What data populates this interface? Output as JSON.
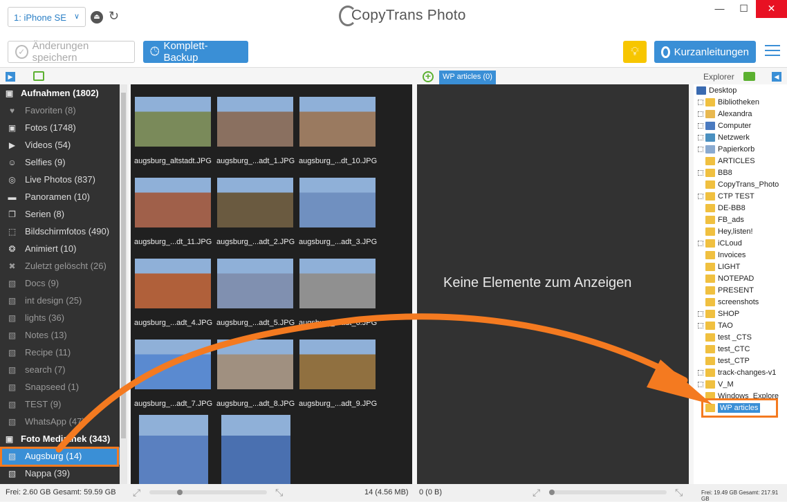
{
  "app": {
    "title": "CopyTrans Photo",
    "colors": {
      "accent": "#3a8fd6",
      "highlight": "#f47a20",
      "tip": "#f7c600"
    }
  },
  "device": {
    "selected": "1: iPhone SE"
  },
  "toolbar": {
    "save_label": "Änderungen speichern",
    "backup_label": "Komplett-Backup",
    "guide_label": "Kurzanleitungen"
  },
  "left_header": {},
  "sidebar": {
    "items": [
      {
        "label": "Aufnahmen (1802)",
        "icon": "camera-icon",
        "type": "header"
      },
      {
        "label": "Favoriten (8)",
        "icon": "heart-icon",
        "type": "dim"
      },
      {
        "label": "Fotos (1748)",
        "icon": "camera-icon",
        "type": "normal"
      },
      {
        "label": "Videos (54)",
        "icon": "video-icon",
        "type": "normal"
      },
      {
        "label": "Selfies (9)",
        "icon": "selfie-icon",
        "type": "normal"
      },
      {
        "label": "Live Photos (837)",
        "icon": "live-photo-icon",
        "type": "normal"
      },
      {
        "label": "Panoramen (10)",
        "icon": "panorama-icon",
        "type": "normal"
      },
      {
        "label": "Serien (8)",
        "icon": "burst-icon",
        "type": "normal"
      },
      {
        "label": "Bildschirmfotos (490)",
        "icon": "screenshot-icon",
        "type": "normal"
      },
      {
        "label": "Animiert (10)",
        "icon": "animated-icon",
        "type": "normal"
      },
      {
        "label": "Zuletzt gelöscht (26)",
        "icon": "trash-icon",
        "type": "dim"
      },
      {
        "label": "Docs (9)",
        "icon": "album-icon",
        "type": "dim"
      },
      {
        "label": "int design (25)",
        "icon": "album-icon",
        "type": "dim"
      },
      {
        "label": "lights (36)",
        "icon": "album-icon",
        "type": "dim"
      },
      {
        "label": "Notes (13)",
        "icon": "album-icon",
        "type": "dim"
      },
      {
        "label": "Recipe (11)",
        "icon": "album-icon",
        "type": "dim"
      },
      {
        "label": "search (7)",
        "icon": "album-icon",
        "type": "dim"
      },
      {
        "label": "Snapseed (1)",
        "icon": "album-icon",
        "type": "dim"
      },
      {
        "label": "TEST (9)",
        "icon": "album-icon",
        "type": "dim"
      },
      {
        "label": "WhatsApp (47)",
        "icon": "album-icon",
        "type": "dim"
      },
      {
        "label": "Foto Mediathek (343)",
        "icon": "camera-icon",
        "type": "header"
      },
      {
        "label": "Augsburg (14)",
        "icon": "album-icon",
        "type": "sel"
      },
      {
        "label": "Nappa (39)",
        "icon": "album-icon",
        "type": "normal"
      }
    ]
  },
  "grid": {
    "photos": [
      {
        "name": "augsburg_altstadt.JPG",
        "color": "#7a8a5a"
      },
      {
        "name": "augsburg_...adt_1.JPG",
        "color": "#8a7060"
      },
      {
        "name": "augsburg_...dt_10.JPG",
        "color": "#9a7a60"
      },
      {
        "name": "augsburg_...dt_11.JPG",
        "color": "#a0604a"
      },
      {
        "name": "augsburg_...adt_2.JPG",
        "color": "#6a5a40"
      },
      {
        "name": "augsburg_...adt_3.JPG",
        "color": "#7090c0"
      },
      {
        "name": "augsburg_...adt_4.JPG",
        "color": "#b0603a"
      },
      {
        "name": "augsburg_...adt_5.JPG",
        "color": "#8090b0"
      },
      {
        "name": "augsburg_...adt_6.JPG",
        "color": "#909090"
      },
      {
        "name": "augsburg_...adt_7.JPG",
        "color": "#5a8ad0"
      },
      {
        "name": "augsburg_...adt_8.JPG",
        "color": "#a09080"
      },
      {
        "name": "augsburg_...adt_9.JPG",
        "color": "#907040"
      },
      {
        "name": "",
        "color": "#5a80c0"
      },
      {
        "name": "",
        "color": "#4a70b0"
      }
    ]
  },
  "mid": {
    "tab_label": "WP articles (0)",
    "empty_text": "Keine Elemente zum Anzeigen"
  },
  "explorer": {
    "title": "Explorer",
    "nodes": [
      {
        "label": "Desktop",
        "level": 0,
        "expand": false,
        "icon": "desktop-icon"
      },
      {
        "label": "Bibliotheken",
        "level": 1,
        "expand": true,
        "icon": "folder-icon"
      },
      {
        "label": "Alexandra",
        "level": 1,
        "expand": true,
        "icon": "user-folder-icon"
      },
      {
        "label": "Computer",
        "level": 1,
        "expand": true,
        "icon": "computer-icon"
      },
      {
        "label": "Netzwerk",
        "level": 1,
        "expand": true,
        "icon": "network-icon"
      },
      {
        "label": "Papierkorb",
        "level": 1,
        "expand": true,
        "icon": "recycle-bin-icon"
      },
      {
        "label": "ARTICLES",
        "level": 1,
        "expand": false,
        "icon": "folder-icon"
      },
      {
        "label": "BB8",
        "level": 1,
        "expand": true,
        "icon": "folder-icon"
      },
      {
        "label": "CopyTrans_Photo",
        "level": 1,
        "expand": false,
        "icon": "folder-icon"
      },
      {
        "label": "CTP TEST",
        "level": 1,
        "expand": true,
        "icon": "folder-icon"
      },
      {
        "label": "DE-BB8",
        "level": 1,
        "expand": false,
        "icon": "folder-icon"
      },
      {
        "label": "FB_ads",
        "level": 1,
        "expand": false,
        "icon": "folder-icon"
      },
      {
        "label": "Hey,listen!",
        "level": 1,
        "expand": false,
        "icon": "folder-icon"
      },
      {
        "label": "iCLoud",
        "level": 1,
        "expand": true,
        "icon": "folder-icon"
      },
      {
        "label": "Invoices",
        "level": 1,
        "expand": false,
        "icon": "folder-icon"
      },
      {
        "label": "LIGHT",
        "level": 1,
        "expand": false,
        "icon": "folder-icon"
      },
      {
        "label": "NOTEPAD",
        "level": 1,
        "expand": false,
        "icon": "folder-icon"
      },
      {
        "label": "PRESENT",
        "level": 1,
        "expand": false,
        "icon": "folder-icon"
      },
      {
        "label": "screenshots",
        "level": 1,
        "expand": false,
        "icon": "folder-icon"
      },
      {
        "label": "SHOP",
        "level": 1,
        "expand": true,
        "icon": "folder-icon"
      },
      {
        "label": "TAO",
        "level": 1,
        "expand": true,
        "icon": "folder-icon"
      },
      {
        "label": "test _CTS",
        "level": 1,
        "expand": false,
        "icon": "folder-icon"
      },
      {
        "label": "test_CTC",
        "level": 1,
        "expand": false,
        "icon": "folder-icon"
      },
      {
        "label": "test_CTP",
        "level": 1,
        "expand": false,
        "icon": "folder-icon"
      },
      {
        "label": "track-changes-v1",
        "level": 1,
        "expand": true,
        "icon": "folder-icon"
      },
      {
        "label": "V_M",
        "level": 1,
        "expand": true,
        "icon": "folder-icon"
      },
      {
        "label": "Windows_Explore",
        "level": 1,
        "expand": false,
        "icon": "folder-icon"
      },
      {
        "label": "WP articles",
        "level": 1,
        "expand": false,
        "icon": "folder-icon",
        "selected": true
      }
    ]
  },
  "status": {
    "left_free": "Frei: 2.60 GB Gesamt: 59.59 GB",
    "grid_count": "14 (4.56 MB)",
    "mid_count": "0 (0 B)",
    "right_free": "Frei: 19.49 GB Gesamt: 217.91 GB"
  }
}
